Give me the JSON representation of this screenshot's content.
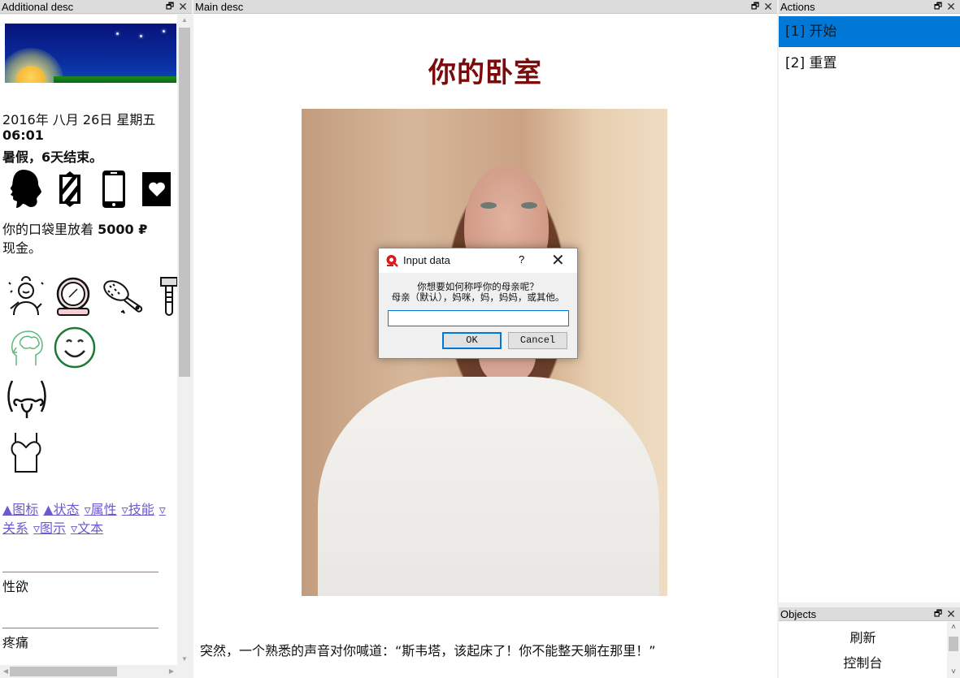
{
  "left_panel": {
    "title": "Additional desc",
    "date_line": "2016年 八月 26日 星期五",
    "time": "06:01",
    "vacation_prefix": "暑假，",
    "vacation_bold": "6天结束。",
    "status_icons": [
      "woman-silhouette-icon",
      "mirror-icon",
      "phone-icon",
      "heart-book-icon"
    ],
    "money_prefix": "你的口袋里放着 ",
    "money_amount": "5000 ₽",
    "money_suffix": "现金。",
    "care_icons": [
      "face-care-icon",
      "compact-mirror-icon",
      "hairbrush-icon",
      "razor-icon"
    ],
    "mood_icons": [
      "brain-icon",
      "smile-icon"
    ],
    "body_icons": [
      "uterus-icon",
      "camisole-icon"
    ],
    "links": [
      {
        "label": "▲图标"
      },
      {
        "label": "▲状态"
      },
      {
        "label": "▿属性"
      },
      {
        "label": "▿技能"
      },
      {
        "label": "▿关系"
      },
      {
        "label": "▿图示"
      },
      {
        "label": "▿文本"
      }
    ],
    "stat_labels": [
      "性欲",
      "疼痛"
    ]
  },
  "main_panel": {
    "title": "Main desc",
    "heading": "你的卧室",
    "story_text": "突然，一个熟悉的声音对你喊道：“斯韦塔，该起床了！你不能整天躺在那里！”"
  },
  "actions_panel": {
    "title": "Actions",
    "items": [
      {
        "label": "[1] 开始",
        "selected": true
      },
      {
        "label": "[2] 重置",
        "selected": false
      }
    ]
  },
  "objects_panel": {
    "title": "Objects",
    "items": [
      {
        "label": "刷新"
      },
      {
        "label": "控制台"
      }
    ]
  },
  "dialog": {
    "title": "Input data",
    "help_label": "?",
    "prompt_line1": "你想要如何称呼你的母亲呢？",
    "prompt_line2": "母亲（默认），妈咪，妈，妈妈，或其他。",
    "input_value": "",
    "ok_label": "OK",
    "cancel_label": "Cancel"
  },
  "colors": {
    "accent": "#0078d7",
    "heading": "#7b0b0b",
    "link": "#6a5acd"
  }
}
